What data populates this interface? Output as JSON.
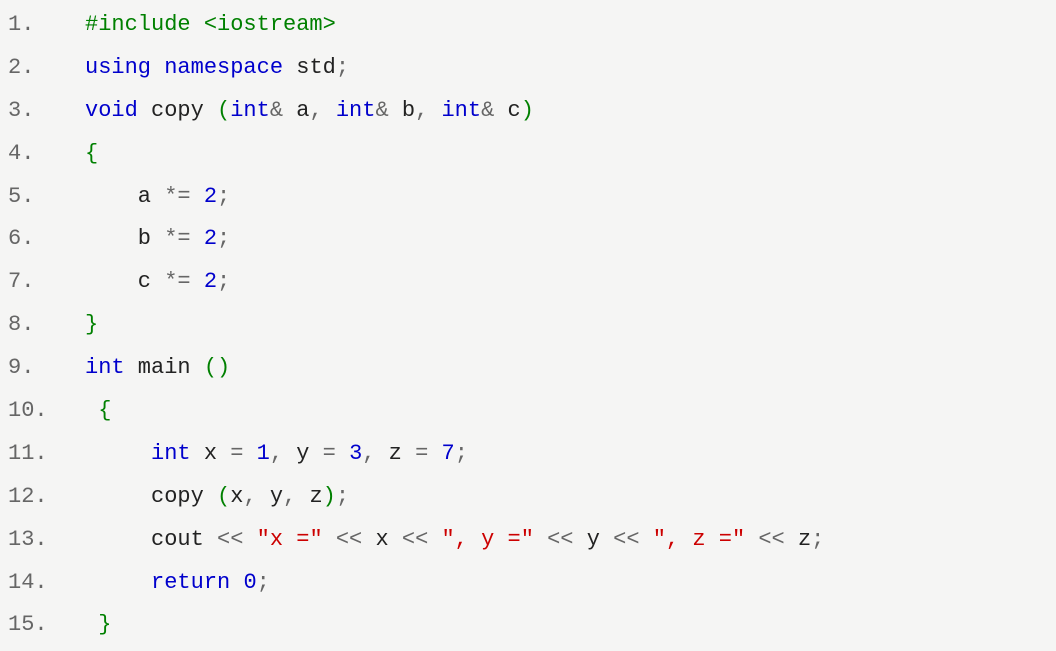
{
  "lines": [
    {
      "n": "1.",
      "tokens": [
        {
          "t": "#include <iostream>",
          "c": "kw-green"
        }
      ]
    },
    {
      "n": "2.",
      "tokens": [
        {
          "t": "using",
          "c": "kw-blue"
        },
        {
          "t": " ",
          "c": "plain"
        },
        {
          "t": "namespace",
          "c": "kw-blue"
        },
        {
          "t": " std",
          "c": "plain"
        },
        {
          "t": ";",
          "c": "punct"
        }
      ]
    },
    {
      "n": "3.",
      "tokens": [
        {
          "t": "void",
          "c": "kw-blue"
        },
        {
          "t": " copy ",
          "c": "plain"
        },
        {
          "t": "(",
          "c": "paren"
        },
        {
          "t": "int",
          "c": "kw-blue"
        },
        {
          "t": "&",
          "c": "op"
        },
        {
          "t": " a",
          "c": "plain"
        },
        {
          "t": ",",
          "c": "punct"
        },
        {
          "t": " ",
          "c": "plain"
        },
        {
          "t": "int",
          "c": "kw-blue"
        },
        {
          "t": "&",
          "c": "op"
        },
        {
          "t": " b",
          "c": "plain"
        },
        {
          "t": ",",
          "c": "punct"
        },
        {
          "t": " ",
          "c": "plain"
        },
        {
          "t": "int",
          "c": "kw-blue"
        },
        {
          "t": "&",
          "c": "op"
        },
        {
          "t": " c",
          "c": "plain"
        },
        {
          "t": ")",
          "c": "paren"
        }
      ]
    },
    {
      "n": "4.",
      "tokens": [
        {
          "t": "{",
          "c": "paren"
        }
      ]
    },
    {
      "n": "5.",
      "tokens": [
        {
          "t": "    a ",
          "c": "plain"
        },
        {
          "t": "*=",
          "c": "op"
        },
        {
          "t": " ",
          "c": "plain"
        },
        {
          "t": "2",
          "c": "num"
        },
        {
          "t": ";",
          "c": "punct"
        }
      ]
    },
    {
      "n": "6.",
      "tokens": [
        {
          "t": "    b ",
          "c": "plain"
        },
        {
          "t": "*=",
          "c": "op"
        },
        {
          "t": " ",
          "c": "plain"
        },
        {
          "t": "2",
          "c": "num"
        },
        {
          "t": ";",
          "c": "punct"
        }
      ]
    },
    {
      "n": "7.",
      "tokens": [
        {
          "t": "    c ",
          "c": "plain"
        },
        {
          "t": "*=",
          "c": "op"
        },
        {
          "t": " ",
          "c": "plain"
        },
        {
          "t": "2",
          "c": "num"
        },
        {
          "t": ";",
          "c": "punct"
        }
      ]
    },
    {
      "n": "8.",
      "tokens": [
        {
          "t": "}",
          "c": "paren"
        }
      ]
    },
    {
      "n": "9.",
      "tokens": [
        {
          "t": "int",
          "c": "kw-blue"
        },
        {
          "t": " main ",
          "c": "plain"
        },
        {
          "t": "()",
          "c": "paren"
        }
      ]
    },
    {
      "n": "10.",
      "tokens": [
        {
          "t": " ",
          "c": "plain"
        },
        {
          "t": "{",
          "c": "paren"
        }
      ]
    },
    {
      "n": "11.",
      "tokens": [
        {
          "t": "     ",
          "c": "plain"
        },
        {
          "t": "int",
          "c": "kw-blue"
        },
        {
          "t": " x ",
          "c": "plain"
        },
        {
          "t": "=",
          "c": "op"
        },
        {
          "t": " ",
          "c": "plain"
        },
        {
          "t": "1",
          "c": "num"
        },
        {
          "t": ",",
          "c": "punct"
        },
        {
          "t": " y ",
          "c": "plain"
        },
        {
          "t": "=",
          "c": "op"
        },
        {
          "t": " ",
          "c": "plain"
        },
        {
          "t": "3",
          "c": "num"
        },
        {
          "t": ",",
          "c": "punct"
        },
        {
          "t": " z ",
          "c": "plain"
        },
        {
          "t": "=",
          "c": "op"
        },
        {
          "t": " ",
          "c": "plain"
        },
        {
          "t": "7",
          "c": "num"
        },
        {
          "t": ";",
          "c": "punct"
        }
      ]
    },
    {
      "n": "12.",
      "tokens": [
        {
          "t": "     copy ",
          "c": "plain"
        },
        {
          "t": "(",
          "c": "paren"
        },
        {
          "t": "x",
          "c": "plain"
        },
        {
          "t": ",",
          "c": "punct"
        },
        {
          "t": " y",
          "c": "plain"
        },
        {
          "t": ",",
          "c": "punct"
        },
        {
          "t": " z",
          "c": "plain"
        },
        {
          "t": ")",
          "c": "paren"
        },
        {
          "t": ";",
          "c": "punct"
        }
      ]
    },
    {
      "n": "13.",
      "tokens": [
        {
          "t": "     cout ",
          "c": "plain"
        },
        {
          "t": "<<",
          "c": "op"
        },
        {
          "t": " ",
          "c": "plain"
        },
        {
          "t": "\"x =\"",
          "c": "str"
        },
        {
          "t": " ",
          "c": "plain"
        },
        {
          "t": "<<",
          "c": "op"
        },
        {
          "t": " x ",
          "c": "plain"
        },
        {
          "t": "<<",
          "c": "op"
        },
        {
          "t": " ",
          "c": "plain"
        },
        {
          "t": "\", y =\"",
          "c": "str"
        },
        {
          "t": " ",
          "c": "plain"
        },
        {
          "t": "<<",
          "c": "op"
        },
        {
          "t": " y ",
          "c": "plain"
        },
        {
          "t": "<<",
          "c": "op"
        },
        {
          "t": " ",
          "c": "plain"
        },
        {
          "t": "\", z =\"",
          "c": "str"
        },
        {
          "t": " ",
          "c": "plain"
        },
        {
          "t": "<<",
          "c": "op"
        },
        {
          "t": " z",
          "c": "plain"
        },
        {
          "t": ";",
          "c": "punct"
        }
      ]
    },
    {
      "n": "14.",
      "tokens": [
        {
          "t": "     ",
          "c": "plain"
        },
        {
          "t": "return",
          "c": "kw-blue"
        },
        {
          "t": " ",
          "c": "plain"
        },
        {
          "t": "0",
          "c": "num"
        },
        {
          "t": ";",
          "c": "punct"
        }
      ]
    },
    {
      "n": "15.",
      "tokens": [
        {
          "t": " ",
          "c": "plain"
        },
        {
          "t": "}",
          "c": "paren"
        }
      ]
    }
  ]
}
